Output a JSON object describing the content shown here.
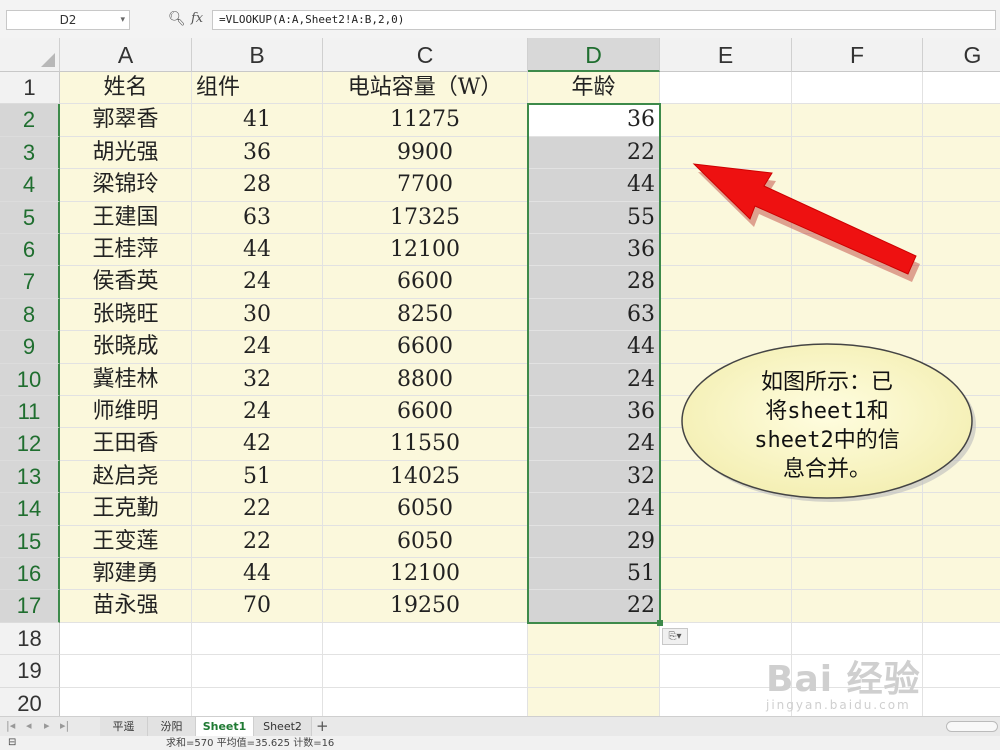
{
  "formula_bar": {
    "name_box": "D2",
    "zoom_icon": "magnifier-icon",
    "fx_label": "fx",
    "formula": "=VLOOKUP(A:A,Sheet2!A:B,2,0)"
  },
  "columns": [
    "A",
    "B",
    "C",
    "D",
    "E",
    "F",
    "G"
  ],
  "selected_column": "D",
  "row_numbers": [
    "1",
    "2",
    "3",
    "4",
    "5",
    "6",
    "7",
    "8",
    "9",
    "10",
    "11",
    "12",
    "13",
    "14",
    "15",
    "16",
    "17",
    "18",
    "19",
    "20"
  ],
  "header_row": [
    "姓名",
    "组件",
    "电站容量（W）",
    "年龄"
  ],
  "rows": [
    [
      "郭翠香",
      "41",
      "11275",
      "36"
    ],
    [
      "胡光强",
      "36",
      "9900",
      "22"
    ],
    [
      "梁锦玲",
      "28",
      "7700",
      "44"
    ],
    [
      "王建国",
      "63",
      "17325",
      "55"
    ],
    [
      "王桂萍",
      "44",
      "12100",
      "36"
    ],
    [
      "侯香英",
      "24",
      "6600",
      "28"
    ],
    [
      "张晓旺",
      "30",
      "8250",
      "63"
    ],
    [
      "张晓成",
      "24",
      "6600",
      "44"
    ],
    [
      "冀桂林",
      "32",
      "8800",
      "24"
    ],
    [
      "师维明",
      "24",
      "6600",
      "36"
    ],
    [
      "王田香",
      "42",
      "11550",
      "24"
    ],
    [
      "赵启尧",
      "51",
      "14025",
      "32"
    ],
    [
      "王克勤",
      "22",
      "6050",
      "24"
    ],
    [
      "王变莲",
      "22",
      "6050",
      "29"
    ],
    [
      "郭建勇",
      "44",
      "12100",
      "51"
    ],
    [
      "苗永强",
      "70",
      "19250",
      "22"
    ]
  ],
  "callout": {
    "lines": [
      "如图所示：已",
      "将sheet1和",
      "sheet2中的信",
      "息合并。"
    ],
    "fill": "#fbf7c2",
    "arrow_color": "#ee1111"
  },
  "paste_options_icon": "paste-options-icon",
  "sheet_tabs": [
    "平遥",
    "汾阳",
    "Sheet1",
    "Sheet2"
  ],
  "active_sheet": "Sheet1",
  "add_sheet": "+",
  "status_bar": {
    "summary": "求和=570  平均值=35.625  计数=16"
  },
  "watermark": {
    "brand": "Bai 经验",
    "url": "jingyan.baidu.com"
  },
  "colors": {
    "highlight_fill": "#fbf8dc",
    "selection_fill": "#d4d4d4",
    "selection_border": "#3d8a4a"
  }
}
